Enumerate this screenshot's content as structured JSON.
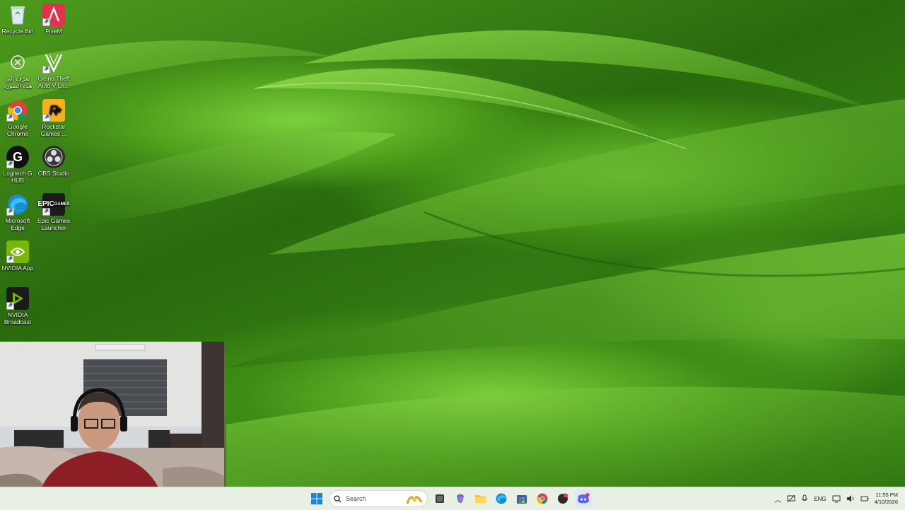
{
  "desktop": {
    "icons": [
      {
        "label": "Recycle Bin",
        "icon": "recycle-bin-icon"
      },
      {
        "label": "FiveM",
        "icon": "fivem-icon"
      },
      {
        "label": "تعرّف إلى هذه الصورة",
        "icon": "spotlight-icon"
      },
      {
        "label": "Grand Theft Auto V Le...",
        "icon": "gta-v-icon"
      },
      {
        "label": "Google Chrome",
        "icon": "chrome-icon"
      },
      {
        "label": "Rockstar Games ...",
        "icon": "rockstar-icon"
      },
      {
        "label": "Logitech G HUB",
        "icon": "logitech-icon"
      },
      {
        "label": "OBS Studio",
        "icon": "obs-icon"
      },
      {
        "label": "Microsoft Edge",
        "icon": "edge-icon"
      },
      {
        "label": "Epic Games Launcher",
        "icon": "epic-icon"
      },
      {
        "label": "NVIDIA App",
        "icon": "nvidia-icon"
      },
      {
        "label": "NVIDIA Broadcast",
        "icon": "nvidia-broadcast-icon"
      }
    ]
  },
  "taskbar": {
    "search_placeholder": "Search",
    "apps": [
      "start-icon",
      "search-icon",
      "task-view-icon",
      "copilot-icon",
      "file-explorer-icon",
      "edge-icon",
      "store-icon",
      "chrome-icon",
      "app-icon",
      "discord-icon"
    ],
    "tray": {
      "language": "ENG",
      "time": "11:55 PM",
      "date": "4/10/2026"
    }
  },
  "colors": {
    "taskbar_bg": "#e9f0e4",
    "wallpaper_green": "#3e8a14"
  }
}
